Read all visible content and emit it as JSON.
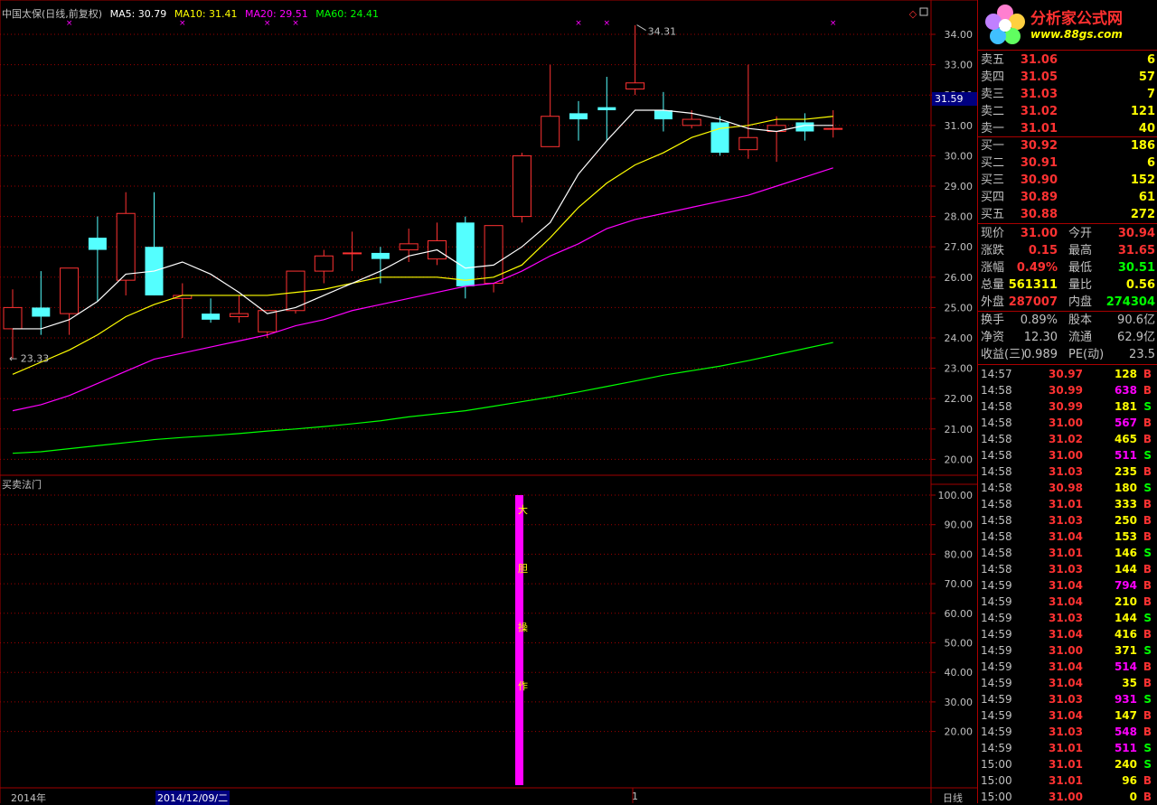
{
  "header": {
    "title": "中国太保(日线,前复权)",
    "ma5": "MA5: 30.79",
    "ma10": "MA10: 31.41",
    "ma20": "MA20: 29.51",
    "ma60": "MA60: 24.41"
  },
  "colors": {
    "up": "#ff3232",
    "down": "#54ffff",
    "ma5": "#ffffff",
    "ma10": "#ffff00",
    "ma20": "#ff00ff",
    "ma60": "#00ff00",
    "grid": "#a00000"
  },
  "price_axis": [
    "34.00",
    "33.00",
    "32.00",
    "31.00",
    "30.00",
    "29.00",
    "28.00",
    "27.00",
    "26.00",
    "25.00",
    "24.00",
    "23.00",
    "22.00",
    "21.00",
    "20.00"
  ],
  "current_price_tag": "31.59",
  "annotations": {
    "high": "34.31",
    "low": "23.33"
  },
  "candles": [
    {
      "o": 24.3,
      "c": 25.0,
      "h": 25.6,
      "l": 23.3
    },
    {
      "o": 25.0,
      "c": 24.7,
      "h": 26.2,
      "l": 24.1
    },
    {
      "o": 24.8,
      "c": 26.3,
      "h": 26.3,
      "l": 24.1
    },
    {
      "o": 27.3,
      "c": 26.9,
      "h": 28.0,
      "l": 25.2
    },
    {
      "o": 25.9,
      "c": 28.1,
      "h": 28.8,
      "l": 25.4
    },
    {
      "o": 27.0,
      "c": 25.4,
      "h": 28.8,
      "l": 25.4
    },
    {
      "o": 25.3,
      "c": 25.4,
      "h": 25.8,
      "l": 24.0
    },
    {
      "o": 24.8,
      "c": 24.6,
      "h": 25.3,
      "l": 24.5
    },
    {
      "o": 24.7,
      "c": 24.8,
      "h": 25.4,
      "l": 24.5
    },
    {
      "o": 24.2,
      "c": 24.9,
      "h": 24.9,
      "l": 24.0
    },
    {
      "o": 24.9,
      "c": 26.2,
      "h": 26.2,
      "l": 24.8
    },
    {
      "o": 26.2,
      "c": 26.7,
      "h": 26.9,
      "l": 25.8
    },
    {
      "o": 26.8,
      "c": 26.8,
      "h": 27.5,
      "l": 26.2
    },
    {
      "o": 26.8,
      "c": 26.6,
      "h": 27.0,
      "l": 25.8
    },
    {
      "o": 26.9,
      "c": 27.1,
      "h": 27.6,
      "l": 26.5
    },
    {
      "o": 26.6,
      "c": 27.2,
      "h": 27.8,
      "l": 26.4
    },
    {
      "o": 27.8,
      "c": 25.7,
      "h": 28.0,
      "l": 25.3
    },
    {
      "o": 25.8,
      "c": 27.7,
      "h": 27.7,
      "l": 25.5
    },
    {
      "o": 28.0,
      "c": 30.0,
      "h": 30.1,
      "l": 27.8
    },
    {
      "o": 30.3,
      "c": 31.3,
      "h": 33.0,
      "l": 30.3
    },
    {
      "o": 31.4,
      "c": 31.2,
      "h": 31.8,
      "l": 30.5
    },
    {
      "o": 31.6,
      "c": 31.5,
      "h": 32.6,
      "l": 30.5
    },
    {
      "o": 32.2,
      "c": 32.4,
      "h": 34.3,
      "l": 32.0
    },
    {
      "o": 31.5,
      "c": 31.2,
      "h": 32.1,
      "l": 30.8
    },
    {
      "o": 31.0,
      "c": 31.2,
      "h": 31.5,
      "l": 30.9
    },
    {
      "o": 31.1,
      "c": 30.1,
      "h": 31.3,
      "l": 30.0
    },
    {
      "o": 30.2,
      "c": 30.6,
      "h": 33.0,
      "l": 29.9
    },
    {
      "o": 30.8,
      "c": 31.0,
      "h": 31.3,
      "l": 29.8
    },
    {
      "o": 31.1,
      "c": 30.8,
      "h": 31.4,
      "l": 30.5
    },
    {
      "o": 30.9,
      "c": 30.9,
      "h": 31.5,
      "l": 30.6
    }
  ],
  "ma5_line": [
    24.3,
    24.3,
    24.6,
    25.2,
    26.1,
    26.2,
    26.5,
    26.1,
    25.5,
    24.8,
    25.0,
    25.4,
    25.8,
    26.2,
    26.7,
    26.9,
    26.3,
    26.4,
    27.0,
    27.8,
    29.4,
    30.5,
    31.5,
    31.5,
    31.4,
    31.2,
    30.9,
    30.8,
    31.0,
    31.0
  ],
  "ma10_line": [
    22.8,
    23.2,
    23.6,
    24.1,
    24.7,
    25.1,
    25.4,
    25.4,
    25.4,
    25.4,
    25.5,
    25.6,
    25.8,
    26.0,
    26.0,
    26.0,
    25.9,
    26.0,
    26.4,
    27.3,
    28.3,
    29.1,
    29.7,
    30.1,
    30.6,
    30.9,
    31.0,
    31.2,
    31.2,
    31.3
  ],
  "ma20_line": [
    21.6,
    21.8,
    22.1,
    22.5,
    22.9,
    23.3,
    23.5,
    23.7,
    23.9,
    24.1,
    24.4,
    24.6,
    24.9,
    25.1,
    25.3,
    25.5,
    25.7,
    25.8,
    26.2,
    26.7,
    27.1,
    27.6,
    27.9,
    28.1,
    28.3,
    28.5,
    28.7,
    29.0,
    29.3,
    29.6
  ],
  "ma60_line": [
    20.2,
    20.25,
    20.35,
    20.45,
    20.55,
    20.65,
    20.72,
    20.78,
    20.85,
    20.93,
    21.0,
    21.08,
    21.17,
    21.27,
    21.4,
    21.5,
    21.6,
    21.75,
    21.9,
    22.05,
    22.22,
    22.4,
    22.58,
    22.77,
    22.92,
    23.07,
    23.25,
    23.45,
    23.65,
    23.85
  ],
  "indicator": {
    "label": "买卖法门",
    "axis": [
      "100.00",
      "90.00",
      "80.00",
      "70.00",
      "60.00",
      "50.00",
      "40.00",
      "30.00",
      "20.00"
    ],
    "bar_value": 100,
    "bar_text": [
      "大",
      "胆",
      "操",
      "作"
    ]
  },
  "bottom": {
    "year": "2014年",
    "date": "2014/12/09/二",
    "marker": "1",
    "period": "日线"
  },
  "logo": {
    "brand": "分析家公式网",
    "url": "www.88gs.com"
  },
  "sell": [
    {
      "label": "卖五",
      "price": "31.06",
      "vol": "6"
    },
    {
      "label": "卖四",
      "price": "31.05",
      "vol": "57"
    },
    {
      "label": "卖三",
      "price": "31.03",
      "vol": "7"
    },
    {
      "label": "卖二",
      "price": "31.02",
      "vol": "121"
    },
    {
      "label": "卖一",
      "price": "31.01",
      "vol": "40"
    }
  ],
  "buy": [
    {
      "label": "买一",
      "price": "30.92",
      "vol": "186"
    },
    {
      "label": "买二",
      "price": "30.91",
      "vol": "6"
    },
    {
      "label": "买三",
      "price": "30.90",
      "vol": "152"
    },
    {
      "label": "买四",
      "price": "30.89",
      "vol": "61"
    },
    {
      "label": "买五",
      "price": "30.88",
      "vol": "272"
    }
  ],
  "quote": [
    {
      "a": "现价",
      "b": "31.00",
      "bc": "#ff3232",
      "d": "今开",
      "e": "30.94",
      "ec": "#ff3232"
    },
    {
      "a": "涨跌",
      "b": "0.15",
      "bc": "#ff3232",
      "d": "最高",
      "e": "31.65",
      "ec": "#ff3232"
    },
    {
      "a": "涨幅",
      "b": "0.49%",
      "bc": "#ff3232",
      "d": "最低",
      "e": "30.51",
      "ec": "#00ff00"
    },
    {
      "a": "总量",
      "b": "561311",
      "bc": "#ffff00",
      "d": "量比",
      "e": "0.56",
      "ec": "#ffff00"
    },
    {
      "a": "外盘",
      "b": "287007",
      "bc": "#ff3232",
      "d": "内盘",
      "e": "274304",
      "ec": "#00ff00"
    }
  ],
  "stats": [
    {
      "a": "换手",
      "b": "0.89%",
      "d": "股本",
      "e": "90.6亿"
    },
    {
      "a": "净资",
      "b": "12.30",
      "d": "流通",
      "e": "62.9亿"
    },
    {
      "a": "收益(三)",
      "b": "0.989",
      "d": "PE(动)",
      "e": "23.5"
    }
  ],
  "ticks": [
    {
      "t": "14:57",
      "p": "30.97",
      "v": "128",
      "f": "B"
    },
    {
      "t": "14:58",
      "p": "30.99",
      "v": "638",
      "f": "B"
    },
    {
      "t": "14:58",
      "p": "30.99",
      "v": "181",
      "f": "S"
    },
    {
      "t": "14:58",
      "p": "31.00",
      "v": "567",
      "f": "B"
    },
    {
      "t": "14:58",
      "p": "31.02",
      "v": "465",
      "f": "B"
    },
    {
      "t": "14:58",
      "p": "31.00",
      "v": "511",
      "f": "S"
    },
    {
      "t": "14:58",
      "p": "31.03",
      "v": "235",
      "f": "B"
    },
    {
      "t": "14:58",
      "p": "30.98",
      "v": "180",
      "f": "S"
    },
    {
      "t": "14:58",
      "p": "31.01",
      "v": "333",
      "f": "B"
    },
    {
      "t": "14:58",
      "p": "31.03",
      "v": "250",
      "f": "B"
    },
    {
      "t": "14:58",
      "p": "31.04",
      "v": "153",
      "f": "B"
    },
    {
      "t": "14:58",
      "p": "31.01",
      "v": "146",
      "f": "S"
    },
    {
      "t": "14:58",
      "p": "31.03",
      "v": "144",
      "f": "B"
    },
    {
      "t": "14:59",
      "p": "31.04",
      "v": "794",
      "f": "B"
    },
    {
      "t": "14:59",
      "p": "31.04",
      "v": "210",
      "f": "B"
    },
    {
      "t": "14:59",
      "p": "31.03",
      "v": "144",
      "f": "S"
    },
    {
      "t": "14:59",
      "p": "31.04",
      "v": "416",
      "f": "B"
    },
    {
      "t": "14:59",
      "p": "31.00",
      "v": "371",
      "f": "S"
    },
    {
      "t": "14:59",
      "p": "31.04",
      "v": "514",
      "f": "B"
    },
    {
      "t": "14:59",
      "p": "31.04",
      "v": "35",
      "f": "B"
    },
    {
      "t": "14:59",
      "p": "31.03",
      "v": "931",
      "f": "S"
    },
    {
      "t": "14:59",
      "p": "31.04",
      "v": "147",
      "f": "B"
    },
    {
      "t": "14:59",
      "p": "31.03",
      "v": "548",
      "f": "B"
    },
    {
      "t": "14:59",
      "p": "31.01",
      "v": "511",
      "f": "S"
    },
    {
      "t": "15:00",
      "p": "31.01",
      "v": "240",
      "f": "S"
    },
    {
      "t": "15:00",
      "p": "31.01",
      "v": "96",
      "f": "B"
    },
    {
      "t": "15:00",
      "p": "31.00",
      "v": "0",
      "f": "B"
    }
  ]
}
